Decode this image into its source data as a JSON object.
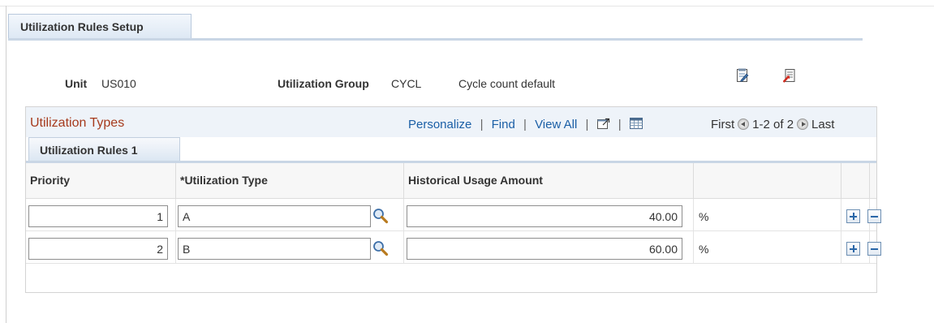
{
  "page_tab": {
    "label": "Utilization Rules Setup"
  },
  "header": {
    "unit_label": "Unit",
    "unit_value": "US010",
    "group_label": "Utilization Group",
    "group_code": "CYCL",
    "group_description": "Cycle count default"
  },
  "toolbar": {
    "icons": [
      "notepad-edit-icon",
      "report-icon"
    ]
  },
  "grid": {
    "title": "Utilization Types",
    "nav": {
      "personalize": "Personalize",
      "find": "Find",
      "view_all": "View All",
      "sep": "|",
      "zoom_icon": "new-window-icon",
      "download_icon": "spreadsheet-icon"
    },
    "pager": {
      "first": "First",
      "range": "1-2 of 2",
      "last": "Last"
    },
    "subtab": "Utilization Rules 1",
    "columns": [
      "Priority",
      "*Utilization Type",
      "Historical Usage Amount",
      "",
      "",
      ""
    ],
    "rows": [
      {
        "priority": "1",
        "type": "A",
        "amount": "40.00",
        "unit": "%"
      },
      {
        "priority": "2",
        "type": "B",
        "amount": "60.00",
        "unit": "%"
      }
    ]
  },
  "colors": {
    "title_accent": "#a63a1c",
    "link": "#1b5fa6",
    "tab_bg": "#dde8f4"
  }
}
